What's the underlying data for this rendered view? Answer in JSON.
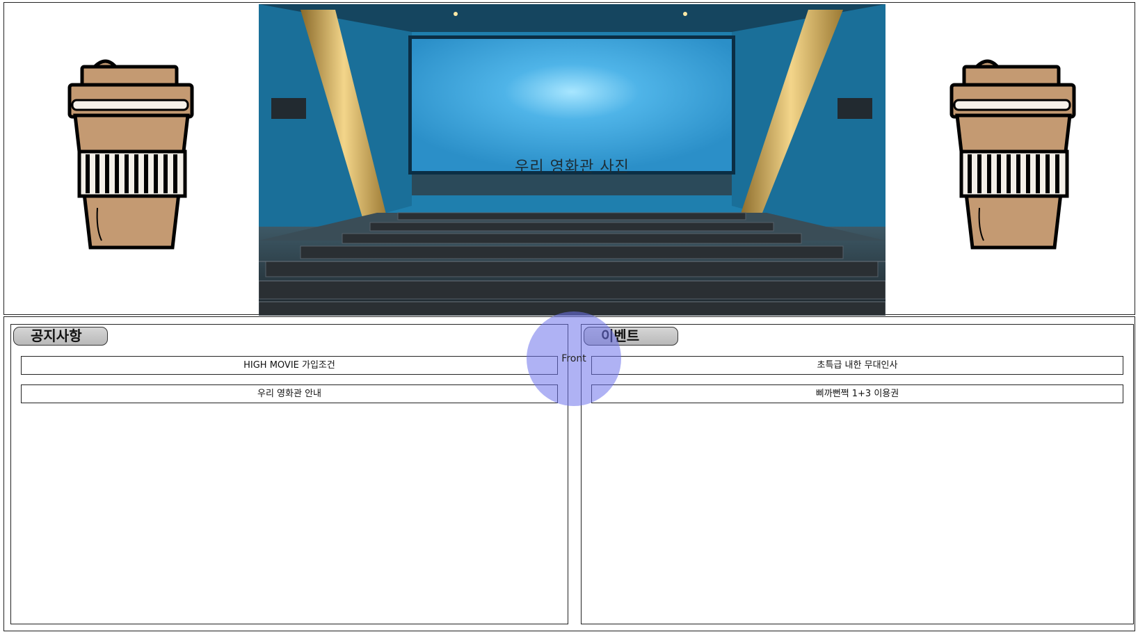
{
  "hero": {
    "photo_caption": "우리 영화관 사진"
  },
  "notice": {
    "title": "공지사항",
    "items": [
      {
        "label": "HIGH MOVIE 가입조건"
      },
      {
        "label": "우리 영화관 안내"
      }
    ]
  },
  "event": {
    "title": "이벤트",
    "items": [
      {
        "label": "초특급 내한 무대인사"
      },
      {
        "label": "삐까뻔쩍 1+3 이용권"
      }
    ]
  },
  "floating": {
    "label": "Front",
    "color": "#6e73eb"
  },
  "icons": {
    "left_cup": "coffee-cup-icon",
    "right_cup": "coffee-cup-icon"
  },
  "colors": {
    "cup_fill": "#c49a72",
    "screen": "#4fb4e8",
    "wall": "#1f7fae",
    "title_bg": "#c8c8c8"
  }
}
